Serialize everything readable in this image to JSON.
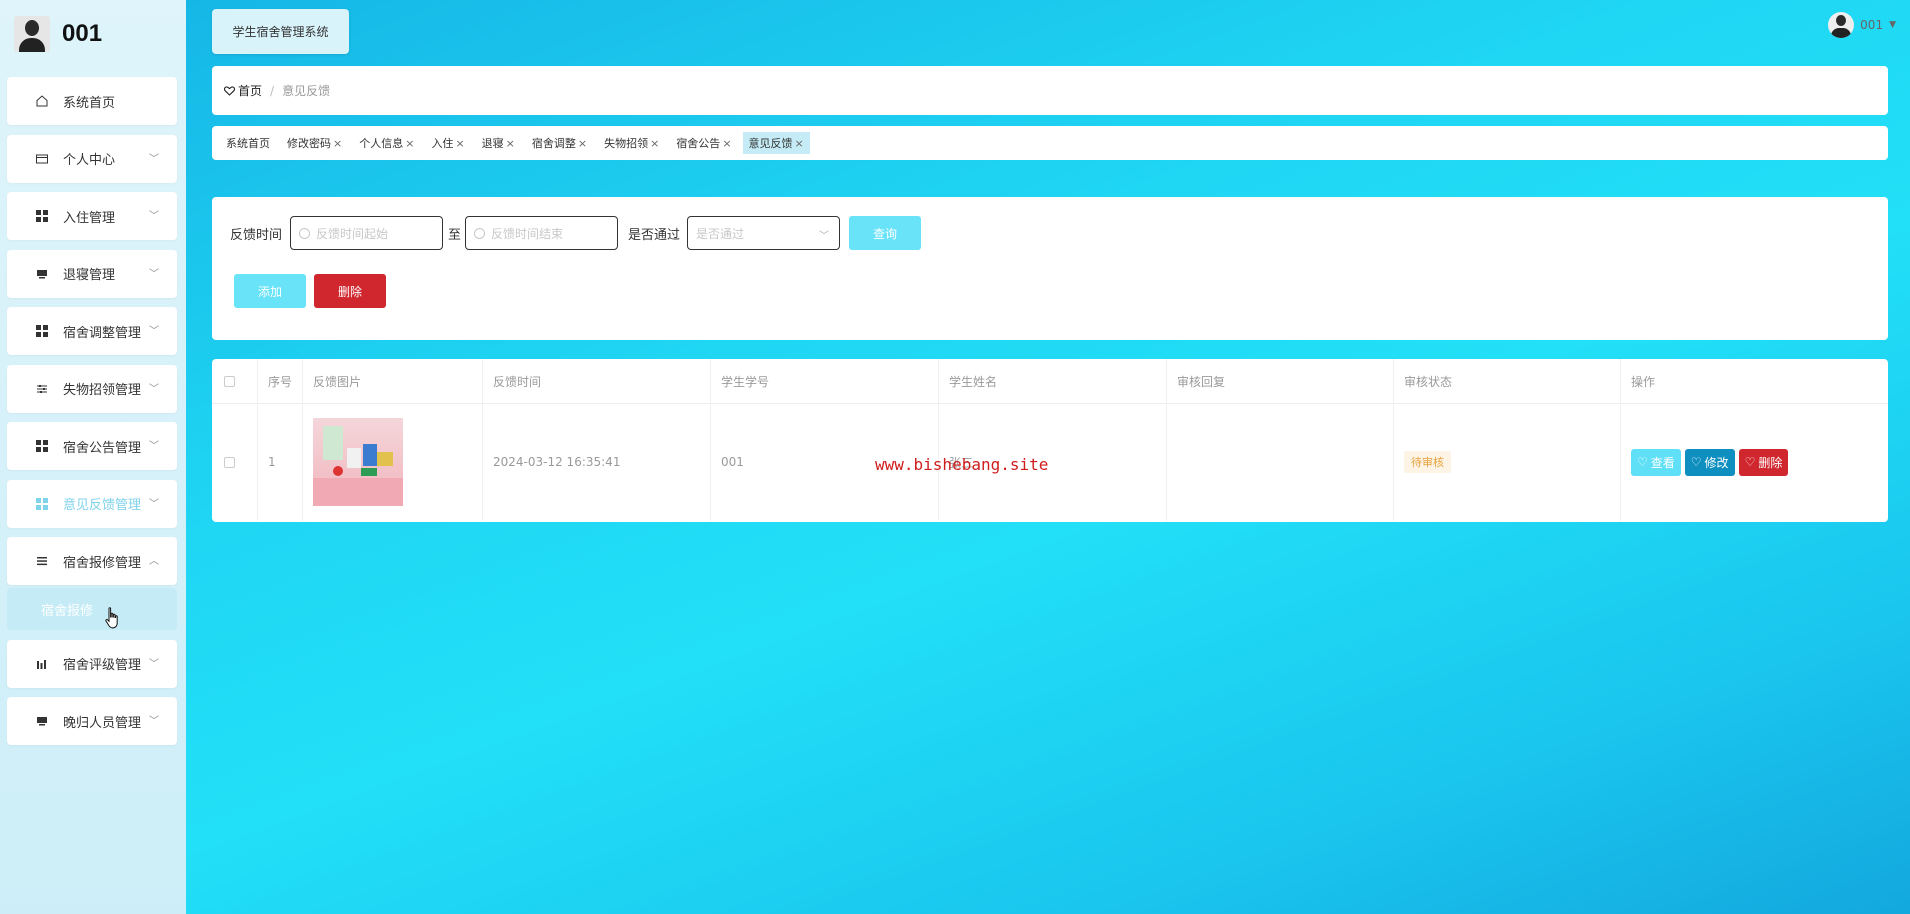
{
  "brand": {
    "name": "001"
  },
  "sidebar": {
    "items": [
      {
        "label": "系统首页",
        "icon": "home-icon"
      },
      {
        "label": "个人中心",
        "icon": "card-icon"
      },
      {
        "label": "入住管理",
        "icon": "grid-icon"
      },
      {
        "label": "退寝管理",
        "icon": "monitor-icon"
      },
      {
        "label": "宿舍调整管理",
        "icon": "grid-icon"
      },
      {
        "label": "失物招领管理",
        "icon": "sliders-icon"
      },
      {
        "label": "宿舍公告管理",
        "icon": "grid-icon"
      },
      {
        "label": "意见反馈管理",
        "icon": "grid-icon",
        "active": true
      },
      {
        "label": "宿舍报修管理",
        "icon": "list-icon",
        "open": true
      },
      {
        "label": "宿舍评级管理",
        "icon": "bar-chart-icon"
      },
      {
        "label": "晚归人员管理",
        "icon": "monitor-icon"
      }
    ],
    "submenu": {
      "label": "宿舍报修"
    }
  },
  "header": {
    "system_title": "学生宿舍管理系统",
    "username": "001"
  },
  "breadcrumb": {
    "home": "首页",
    "separator": "/",
    "current": "意见反馈"
  },
  "tags": [
    {
      "label": "系统首页",
      "closable": false
    },
    {
      "label": "修改密码",
      "closable": true
    },
    {
      "label": "个人信息",
      "closable": true
    },
    {
      "label": "入住",
      "closable": true
    },
    {
      "label": "退寝",
      "closable": true
    },
    {
      "label": "宿舍调整",
      "closable": true
    },
    {
      "label": "失物招领",
      "closable": true
    },
    {
      "label": "宿舍公告",
      "closable": true
    },
    {
      "label": "意见反馈",
      "closable": true,
      "active": true
    }
  ],
  "search": {
    "time_label": "反馈时间",
    "start_placeholder": "反馈时间起始",
    "range_sep": "至",
    "end_placeholder": "反馈时间结束",
    "pass_label": "是否通过",
    "pass_placeholder": "是否通过",
    "query_label": "查询",
    "add_label": "添加",
    "delete_label": "删除"
  },
  "table": {
    "headers": [
      "序号",
      "反馈图片",
      "反馈时间",
      "学生学号",
      "学生姓名",
      "审核回复",
      "审核状态",
      "操作"
    ],
    "rows": [
      {
        "index": "1",
        "time": "2024-03-12 16:35:41",
        "student_no": "001",
        "student_name": "张三",
        "reply": "",
        "status": "待审核"
      }
    ],
    "actions": {
      "view": "查看",
      "edit": "修改",
      "delete": "删除"
    }
  },
  "watermark": "www.bishebang.site",
  "colors": {
    "accent": "#68e3f8",
    "danger": "#d0262e",
    "edit": "#0e8fbf"
  }
}
